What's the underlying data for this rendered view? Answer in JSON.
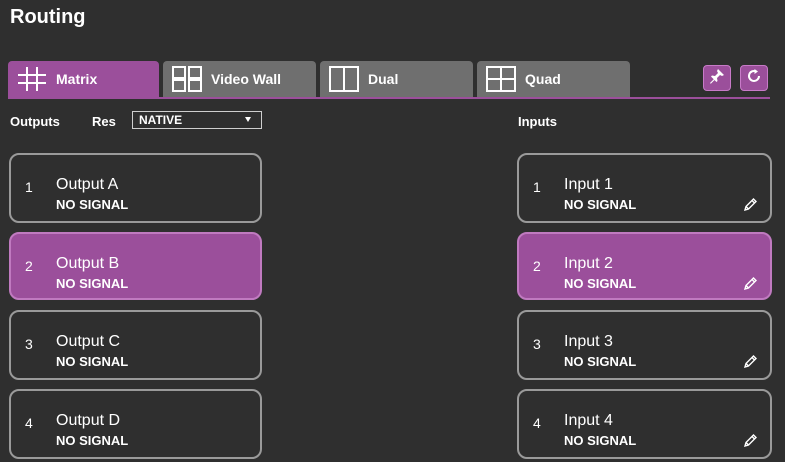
{
  "header": {
    "title": "Routing"
  },
  "tabs": [
    {
      "label": "Matrix",
      "icon": "matrix-grid-icon",
      "active": true
    },
    {
      "label": "Video Wall",
      "icon": "video-wall-icon",
      "active": false
    },
    {
      "label": "Dual",
      "icon": "dual-view-icon",
      "active": false
    },
    {
      "label": "Quad",
      "icon": "quad-view-icon",
      "active": false
    }
  ],
  "actions": {
    "pin_icon": "pin-icon",
    "refresh_icon": "refresh-icon"
  },
  "outputs": {
    "label": "Outputs",
    "res_label": "Res",
    "res_value": "NATIVE",
    "items": [
      {
        "num": "1",
        "name": "Output A",
        "status": "NO SIGNAL",
        "selected": false
      },
      {
        "num": "2",
        "name": "Output B",
        "status": "NO SIGNAL",
        "selected": true
      },
      {
        "num": "3",
        "name": "Output C",
        "status": "NO SIGNAL",
        "selected": false
      },
      {
        "num": "4",
        "name": "Output D",
        "status": "NO SIGNAL",
        "selected": false
      }
    ]
  },
  "inputs": {
    "label": "Inputs",
    "items": [
      {
        "num": "1",
        "name": "Input 1",
        "status": "NO SIGNAL",
        "selected": false,
        "icon": "edit-pencil-icon"
      },
      {
        "num": "2",
        "name": "Input 2",
        "status": "NO SIGNAL",
        "selected": true,
        "icon": "edit-pencil-icon"
      },
      {
        "num": "3",
        "name": "Input 3",
        "status": "NO SIGNAL",
        "selected": false,
        "icon": "edit-pencil-icon"
      },
      {
        "num": "4",
        "name": "Input 4",
        "status": "NO SIGNAL",
        "selected": false,
        "icon": "edit-pencil-icon"
      }
    ]
  },
  "colors": {
    "accent": "#9b4f9b",
    "background": "#2f2f2f",
    "tab_inactive": "#6f6f6f",
    "border": "#9a9a9a"
  }
}
